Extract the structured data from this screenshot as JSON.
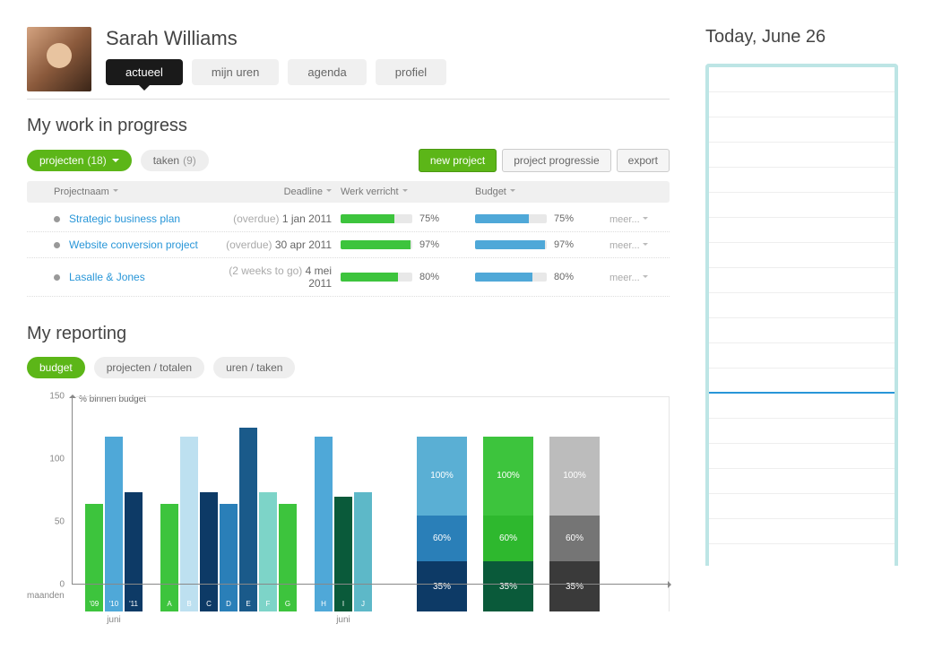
{
  "user": {
    "name": "Sarah Williams"
  },
  "tabs": [
    "actueel",
    "mijn uren",
    "agenda",
    "profiel"
  ],
  "sections": {
    "work_title": "My work in progress",
    "reporting_title": "My reporting"
  },
  "filters": {
    "projecten": {
      "label": "projecten",
      "count": "(18)"
    },
    "taken": {
      "label": "taken",
      "count": "(9)"
    }
  },
  "buttons": {
    "new_project": "new project",
    "project_progressie": "project progressie",
    "export": "export"
  },
  "table": {
    "headers": {
      "name": "Projectnaam",
      "deadline": "Deadline",
      "werk": "Werk verricht",
      "budget": "Budget"
    },
    "rows": [
      {
        "name": "Strategic business plan",
        "note": "(overdue)",
        "date": "1 jan 2011",
        "werk": 75,
        "budget": 75,
        "more": "meer..."
      },
      {
        "name": "Website conversion project",
        "note": "(overdue)",
        "date": "30 apr 2011",
        "werk": 97,
        "budget": 97,
        "more": "meer..."
      },
      {
        "name": "Lasalle & Jones",
        "note": "(2 weeks to go)",
        "date": "4 mei 2011",
        "werk": 80,
        "budget": 80,
        "more": "meer..."
      }
    ]
  },
  "report_tabs": [
    "budget",
    "projecten / totalen",
    "uren / taken"
  ],
  "today_title": "Today, June 26",
  "chart_data": [
    {
      "type": "bar",
      "title": "",
      "ylabel": "% binnen budget",
      "xlabel": "maanden",
      "ylim": [
        0,
        150
      ],
      "groups": [
        {
          "label": "juni",
          "series": [
            {
              "name": "'09",
              "value": 75,
              "color": "#3dc43d"
            },
            {
              "name": "'10",
              "value": 122,
              "color": "#4fa8d8"
            },
            {
              "name": "'11",
              "value": 83,
              "color": "#0d3a66"
            }
          ]
        },
        {
          "label": "",
          "series": [
            {
              "name": "A",
              "value": 75,
              "color": "#3dc43d"
            },
            {
              "name": "B",
              "value": 122,
              "color": "#bde0f0"
            },
            {
              "name": "C",
              "value": 83,
              "color": "#0d3a66"
            },
            {
              "name": "D",
              "value": 75,
              "color": "#2a7fb8"
            },
            {
              "name": "E",
              "value": 128,
              "color": "#1a5a8a"
            },
            {
              "name": "F",
              "value": 83,
              "color": "#7dd4c8"
            },
            {
              "name": "G",
              "value": 75,
              "color": "#3dc43d"
            }
          ]
        },
        {
          "label": "juni",
          "series": [
            {
              "name": "H",
              "value": 122,
              "color": "#4fa8d8"
            },
            {
              "name": "I",
              "value": 80,
              "color": "#0a5a3a"
            },
            {
              "name": "J",
              "value": 83,
              "color": "#5db8c8"
            }
          ]
        }
      ]
    },
    {
      "type": "bar",
      "subtype": "stacked",
      "ylim": [
        0,
        150
      ],
      "stacks": [
        {
          "segments": [
            {
              "label": "35%",
              "value": 35,
              "color": "#0d3a66"
            },
            {
              "label": "60%",
              "value": 32,
              "color": "#2a7fb8"
            },
            {
              "label": "100%",
              "value": 55,
              "color": "#5aafd4"
            }
          ]
        },
        {
          "segments": [
            {
              "label": "35%",
              "value": 35,
              "color": "#0a5a3a"
            },
            {
              "label": "60%",
              "value": 32,
              "color": "#2eb82e"
            },
            {
              "label": "100%",
              "value": 55,
              "color": "#3dc43d"
            }
          ]
        },
        {
          "segments": [
            {
              "label": "35%",
              "value": 35,
              "color": "#3a3a3a"
            },
            {
              "label": "60%",
              "value": 32,
              "color": "#757575"
            },
            {
              "label": "100%",
              "value": 55,
              "color": "#bcbcbc"
            }
          ]
        }
      ]
    }
  ]
}
